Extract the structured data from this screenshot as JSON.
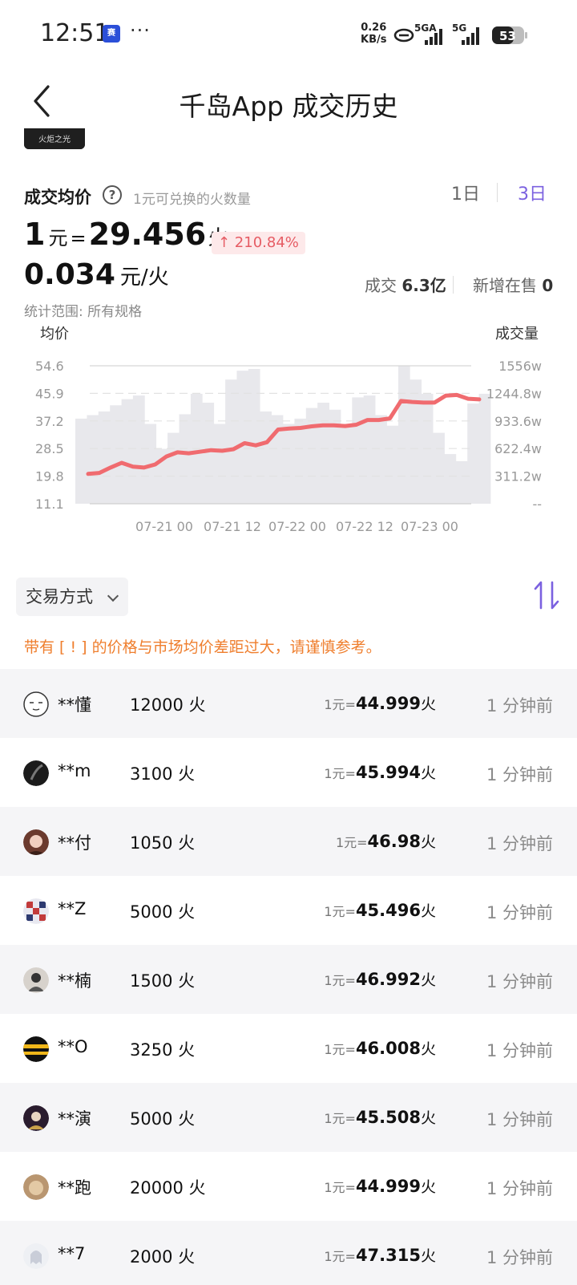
{
  "status": {
    "time": "12:51",
    "app_badge": "赛",
    "more": "···",
    "net_speed": "0.26",
    "net_unit": "KB/s",
    "sim1": "5GA",
    "sim2": "5G",
    "battery": "53"
  },
  "nav": {
    "title": "千岛App 成交历史"
  },
  "peek": {
    "badge": "火炬之光"
  },
  "summary": {
    "label": "成交均价",
    "hint": "1元可兑换的火数量",
    "tabs": [
      "1日",
      "3日"
    ],
    "rate_lhs": "1",
    "rate_unit": "元",
    "rate_eq": "=",
    "rate_value": "29.456",
    "rate_unit2": "火",
    "change": "↑ 210.84%",
    "inverse_value": "0.034",
    "inverse_unit": "元/火",
    "scope": "统计范围: 所有规格",
    "deal_label": "成交",
    "deal_value": "6.3亿",
    "new_label": "新增在售",
    "new_value": "0"
  },
  "chart_data": {
    "type": "line",
    "left_axis_title": "均价",
    "right_axis_title": "成交量",
    "left_ticks": [
      "54.6",
      "45.9",
      "37.2",
      "28.5",
      "19.8",
      "11.1"
    ],
    "right_ticks": [
      "1556w",
      "1244.8w",
      "933.6w",
      "622.4w",
      "311.2w",
      "--"
    ],
    "x_ticks": [
      "07-21 00",
      "07-21 12",
      "07-22 00",
      "07-22 12",
      "07-23 00"
    ],
    "ylim": [
      11.1,
      54.6
    ],
    "volume_ylim": [
      0,
      1556
    ],
    "colors": {
      "line": "#f06b6f",
      "volume": "#e8e8ec"
    },
    "price_series": [
      {
        "x": 0,
        "y": 20.5
      },
      {
        "x": 1,
        "y": 20.8
      },
      {
        "x": 2,
        "y": 22.5
      },
      {
        "x": 3,
        "y": 24.0
      },
      {
        "x": 4,
        "y": 22.8
      },
      {
        "x": 5,
        "y": 22.5
      },
      {
        "x": 6,
        "y": 23.5
      },
      {
        "x": 7,
        "y": 26.0
      },
      {
        "x": 8,
        "y": 27.3
      },
      {
        "x": 9,
        "y": 27.0
      },
      {
        "x": 10,
        "y": 27.5
      },
      {
        "x": 11,
        "y": 28.0
      },
      {
        "x": 12,
        "y": 27.8
      },
      {
        "x": 13,
        "y": 28.3
      },
      {
        "x": 14,
        "y": 30.2
      },
      {
        "x": 15,
        "y": 29.5
      },
      {
        "x": 16,
        "y": 30.5
      },
      {
        "x": 17,
        "y": 34.5
      },
      {
        "x": 18,
        "y": 34.8
      },
      {
        "x": 19,
        "y": 35.0
      },
      {
        "x": 20,
        "y": 35.5
      },
      {
        "x": 21,
        "y": 35.8
      },
      {
        "x": 22,
        "y": 35.8
      },
      {
        "x": 23,
        "y": 35.6
      },
      {
        "x": 24,
        "y": 36.0
      },
      {
        "x": 25,
        "y": 37.5
      },
      {
        "x": 26,
        "y": 37.5
      },
      {
        "x": 27,
        "y": 38.0
      },
      {
        "x": 28,
        "y": 43.5
      },
      {
        "x": 29,
        "y": 43.2
      },
      {
        "x": 30,
        "y": 43.0
      },
      {
        "x": 31,
        "y": 43.0
      },
      {
        "x": 32,
        "y": 45.2
      },
      {
        "x": 33,
        "y": 45.4
      },
      {
        "x": 34,
        "y": 44.2
      },
      {
        "x": 35,
        "y": 44.0
      }
    ],
    "volume_series": [
      960,
      1000,
      1040,
      1110,
      1180,
      1220,
      900,
      620,
      800,
      1010,
      1240,
      1140,
      900,
      1400,
      1500,
      1520,
      1040,
      1000,
      900,
      960,
      1080,
      1140,
      1060,
      900,
      1200,
      1220,
      1000,
      880,
      1560,
      1400,
      1240,
      800,
      560,
      480,
      1130,
      1240
    ]
  },
  "filter": {
    "label": "交易方式"
  },
  "warning": "带有 [ ! ] 的价格与市场均价差距过大，请谨慎参考。",
  "trades": [
    {
      "user": "**懂",
      "amount": "12000 火",
      "price_pre": "1元=",
      "price": "44.999",
      "price_suf": "火",
      "time": "1 分钟前",
      "avatar": "face"
    },
    {
      "user": "**m",
      "amount": "3100 火",
      "price_pre": "1元=",
      "price": "45.994",
      "price_suf": "火",
      "time": "1 分钟前",
      "avatar": "dark"
    },
    {
      "user": "**付",
      "amount": "1050 火",
      "price_pre": "1元=",
      "price": "46.98",
      "price_suf": "火",
      "time": "1 分钟前",
      "avatar": "girl"
    },
    {
      "user": "**Z",
      "amount": "5000 火",
      "price_pre": "1元=",
      "price": "45.496",
      "price_suf": "火",
      "time": "1 分钟前",
      "avatar": "checker"
    },
    {
      "user": "**楠",
      "amount": "1500 火",
      "price_pre": "1元=",
      "price": "46.992",
      "price_suf": "火",
      "time": "1 分钟前",
      "avatar": "sketch"
    },
    {
      "user": "**O",
      "amount": "3250 火",
      "price_pre": "1元=",
      "price": "46.008",
      "price_suf": "火",
      "time": "1 分钟前",
      "avatar": "stripe"
    },
    {
      "user": "**演",
      "amount": "5000 火",
      "price_pre": "1元=",
      "price": "45.508",
      "price_suf": "火",
      "time": "1 分钟前",
      "avatar": "stage"
    },
    {
      "user": "**跑",
      "amount": "20000 火",
      "price_pre": "1元=",
      "price": "44.999",
      "price_suf": "火",
      "time": "1 分钟前",
      "avatar": "pet"
    },
    {
      "user": "**7",
      "amount": "2000 火",
      "price_pre": "1元=",
      "price": "47.315",
      "price_suf": "火",
      "time": "1 分钟前",
      "avatar": "ghost"
    }
  ]
}
